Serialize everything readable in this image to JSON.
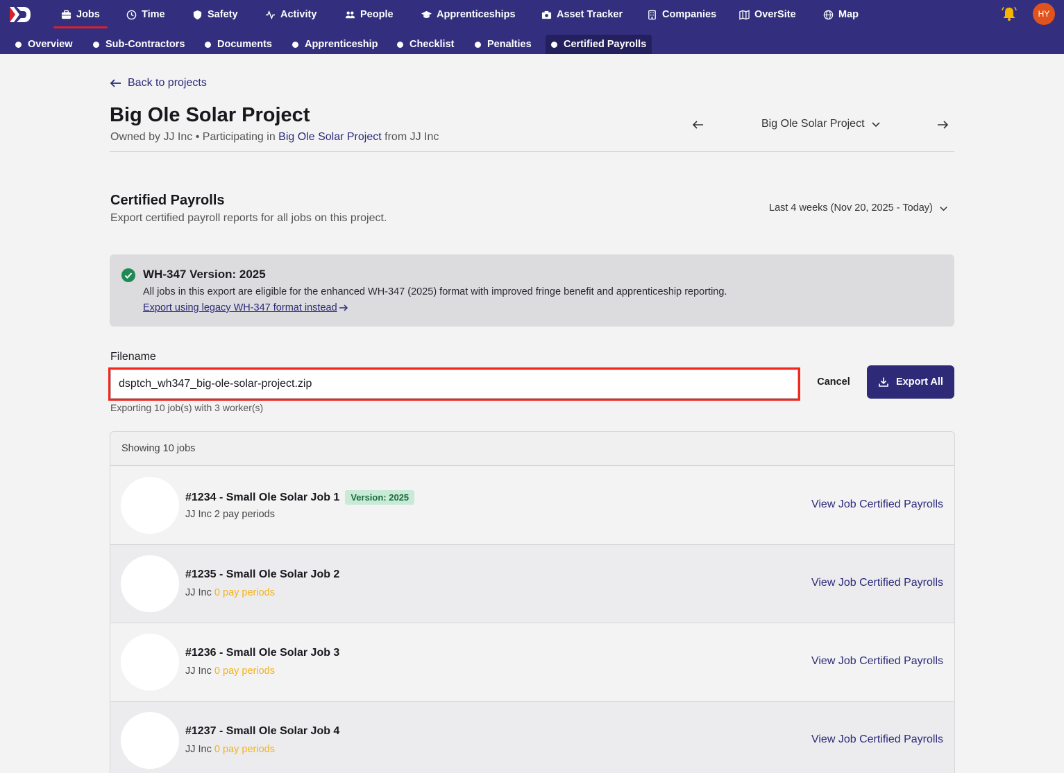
{
  "topnav": {
    "items": [
      {
        "label": "Jobs",
        "icon": "briefcase-icon"
      },
      {
        "label": "Time",
        "icon": "clock-icon"
      },
      {
        "label": "Safety",
        "icon": "shield-icon"
      },
      {
        "label": "Activity",
        "icon": "activity-icon"
      },
      {
        "label": "People",
        "icon": "people-icon"
      },
      {
        "label": "Apprenticeships",
        "icon": "graduation-cap-icon"
      },
      {
        "label": "Asset Tracker",
        "icon": "camera-icon"
      },
      {
        "label": "Companies",
        "icon": "building-icon"
      },
      {
        "label": "OverSite",
        "icon": "map-book-icon"
      },
      {
        "label": "Map",
        "icon": "globe-icon"
      }
    ],
    "avatar_initials": "HY"
  },
  "subnav": {
    "items": [
      {
        "label": "Overview"
      },
      {
        "label": "Sub-Contractors"
      },
      {
        "label": "Documents"
      },
      {
        "label": "Apprenticeship"
      },
      {
        "label": "Checklist"
      },
      {
        "label": "Penalties"
      },
      {
        "label": "Certified Payrolls"
      }
    ],
    "active": "Certified Payrolls"
  },
  "header": {
    "back_label": "Back to projects",
    "title": "Big Ole Solar Project",
    "owned_prefix": "Owned by JJ Inc • Participating in",
    "project_link": "Big Ole Solar Project",
    "owned_suffix": "from JJ Inc",
    "project_select": "Big Ole Solar Project"
  },
  "section": {
    "title": "Certified Payrolls",
    "subtitle": "Export certified payroll reports for all jobs on this project.",
    "date_range": "Last 4 weeks (Nov 20, 2025 - Today)"
  },
  "alert": {
    "title": "WH-347 Version: 2025",
    "body": "All jobs in this export are eligible for the enhanced WH-347 (2025) format with improved fringe benefit and apprenticeship reporting.",
    "link": "Export using legacy WH-347 format instead"
  },
  "export": {
    "filename_label": "Filename",
    "filename_value": "dsptch_wh347_big-ole-solar-project.zip",
    "hint": "Exporting 10 job(s) with 3 worker(s)",
    "cancel_label": "Cancel",
    "export_label": "Export All"
  },
  "jobs": {
    "header": "Showing 10 jobs",
    "link_label": "View Job Certified Payrolls",
    "rows": [
      {
        "title": "#1234 - Small Ole Solar Job 1",
        "badge": "Version: 2025",
        "company": "JJ Inc",
        "periods": "2 pay periods",
        "periods_warn": false
      },
      {
        "title": "#1235 - Small Ole Solar Job 2",
        "badge": "",
        "company": "JJ Inc",
        "periods": "0 pay periods",
        "periods_warn": true
      },
      {
        "title": "#1236 - Small Ole Solar Job 3",
        "badge": "",
        "company": "JJ Inc",
        "periods": "0 pay periods",
        "periods_warn": true
      },
      {
        "title": "#1237 - Small Ole Solar Job 4",
        "badge": "",
        "company": "JJ Inc",
        "periods": "0 pay periods",
        "periods_warn": true
      }
    ]
  },
  "colors": {
    "nav_bg": "#332f7e",
    "accent_red": "#d8222a",
    "link": "#2b2a7a",
    "highlight_border": "#f2281c",
    "warn": "#f2b21c",
    "success": "#1f8a55"
  }
}
